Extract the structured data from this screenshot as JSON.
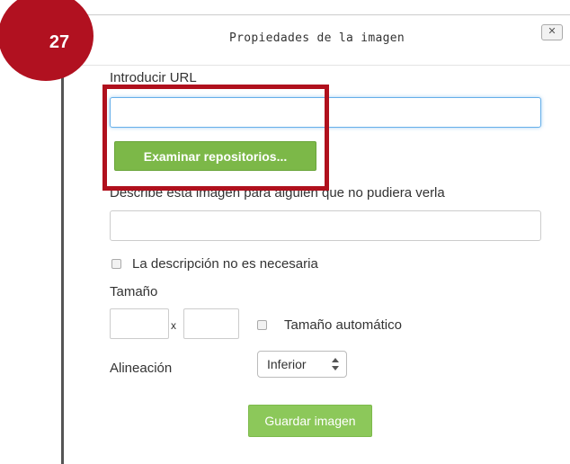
{
  "badge": {
    "number": "27"
  },
  "dialog": {
    "title": "Propiedades de la imagen",
    "close_label": "✕",
    "url_label": "Introducir URL",
    "url_value": "",
    "browse_button": "Examinar repositorios...",
    "description_label": "Describe esta imagen para alguien que no pudiera verla",
    "description_value": "",
    "no_description_label": "La descripción no es necesaria",
    "size_label": "Tamaño",
    "size_separator": "x",
    "auto_size_label": "Tamaño automático",
    "alignment_label": "Alineación",
    "alignment_value": "Inferior",
    "save_button": "Guardar imagen"
  },
  "colors": {
    "accent_green": "#7cb848",
    "badge_red": "#b11120",
    "highlight_red": "#b0101d",
    "focus_blue": "#66afe9"
  }
}
